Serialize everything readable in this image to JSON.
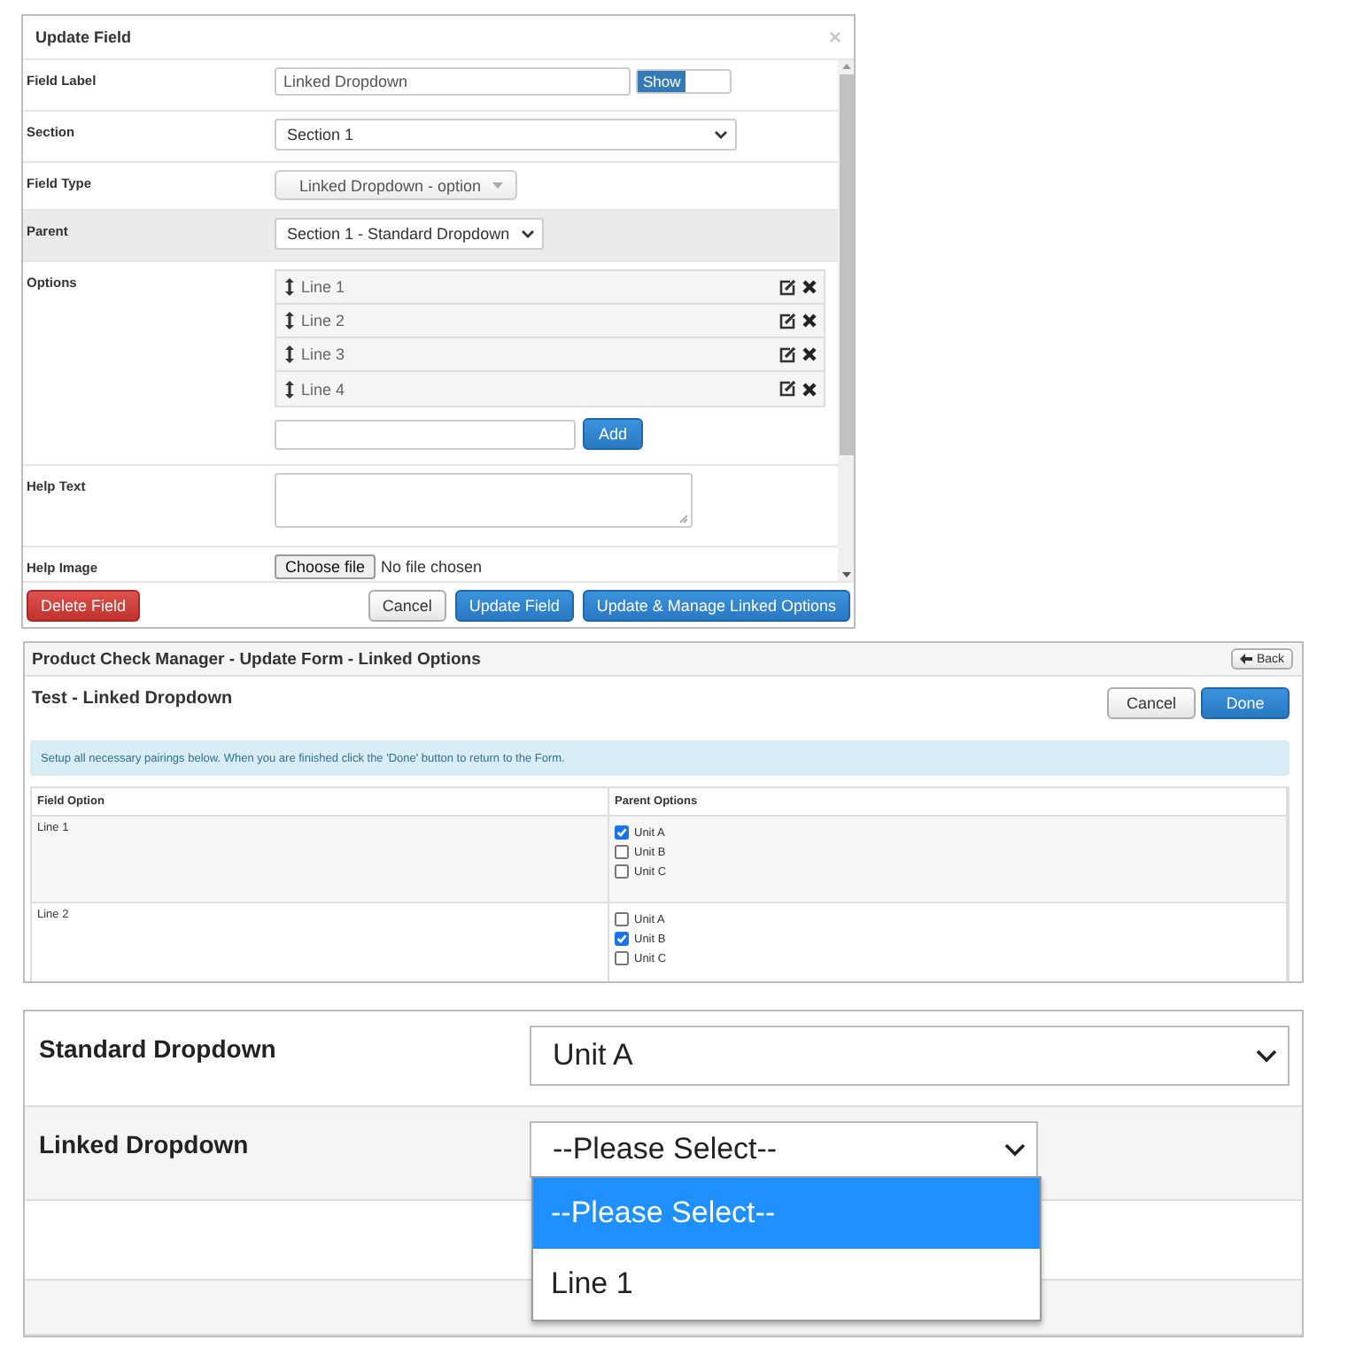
{
  "update_field": {
    "title": "Update Field",
    "close": "×",
    "rows": [
      {
        "kind": "text",
        "label": "Field Label",
        "value": "Linked Dropdown",
        "toggle": {
          "label": "Show",
          "on": true
        },
        "highlighted": false
      },
      {
        "kind": "select",
        "label": "Section",
        "value": "Section 1",
        "highlighted": false
      },
      {
        "kind": "button-select",
        "label": "Field Type",
        "value": "Linked Dropdown - option",
        "highlighted": false
      },
      {
        "kind": "select",
        "label": "Parent",
        "value": "Section 1 - Standard Dropdown",
        "highlighted": true
      },
      {
        "kind": "options",
        "label": "Options",
        "options": [
          "Line 1",
          "Line 2",
          "Line 3",
          "Line 4"
        ],
        "add_button": "Add",
        "highlighted": false
      },
      {
        "kind": "textarea",
        "label": "Help Text",
        "highlighted": false
      },
      {
        "kind": "file",
        "label": "Help Image",
        "button": "Choose file",
        "status": "No file chosen",
        "highlighted": false
      }
    ],
    "footer": {
      "buttons": [
        {
          "label": "Delete Field",
          "kind": "danger"
        },
        {
          "label": "Cancel",
          "kind": "default"
        },
        {
          "label": "Update Field",
          "kind": "primary"
        },
        {
          "label": "Update & Manage Linked Options",
          "kind": "primary"
        }
      ]
    }
  },
  "linked_options": {
    "title": "Product Check Manager - Update Form - Linked Options",
    "back_button": "Back",
    "heading": "Test - Linked Dropdown",
    "buttons": [
      {
        "label": "Cancel",
        "kind": "default"
      },
      {
        "label": "Done",
        "kind": "primary"
      }
    ],
    "info": "Setup all necessary pairings below. When you are finished click the 'Done' button to return to the Form.",
    "table": {
      "columns": [
        "Field Option",
        "Parent Options"
      ],
      "rows": [
        {
          "option": "Line 1",
          "parents": [
            {
              "label": "Unit A",
              "checked": true
            },
            {
              "label": "Unit B",
              "checked": false
            },
            {
              "label": "Unit C",
              "checked": false
            }
          ]
        },
        {
          "option": "Line 2",
          "parents": [
            {
              "label": "Unit A",
              "checked": false
            },
            {
              "label": "Unit B",
              "checked": true
            },
            {
              "label": "Unit C",
              "checked": false
            }
          ]
        }
      ]
    }
  },
  "preview": {
    "rows": [
      {
        "label": "Standard Dropdown",
        "value": "Unit A"
      },
      {
        "label": "Linked Dropdown",
        "value": "--Please Select--",
        "list": [
          {
            "label": "--Please Select--",
            "selected": true
          },
          {
            "label": "Line 1",
            "selected": false
          }
        ]
      }
    ]
  }
}
